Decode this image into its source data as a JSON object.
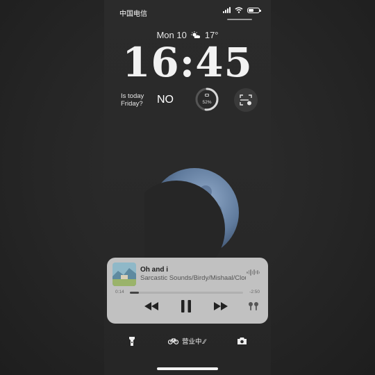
{
  "status_bar": {
    "carrier": "中国电信",
    "signal_bars": 4,
    "wifi": true,
    "battery_percent": 52
  },
  "lock_screen": {
    "date": "Mon 10",
    "weather_icon": "partly-sunny-icon",
    "temperature": "17°",
    "time": "16:45"
  },
  "widgets": {
    "question": "Is today\nFriday?",
    "answer": "NO",
    "battery_ring": {
      "label": "52%",
      "value": 0.52
    },
    "scan_icon": "scan-icon"
  },
  "now_playing": {
    "song": "Oh and i",
    "artist": "Sarcastic Sounds/Birdy/Mishaal/Cloudy",
    "elapsed": "0:14",
    "remaining": "-2:50",
    "progress": 0.08,
    "controls": [
      "rewind-icon",
      "pause-icon",
      "fast-forward-icon",
      "airpods-icon"
    ]
  },
  "bottom_bar": {
    "flashlight_icon": "flashlight-icon",
    "bike_icon": "bicycle-icon",
    "status_text": "营业中.⁄⁄",
    "camera_icon": "camera-icon"
  }
}
